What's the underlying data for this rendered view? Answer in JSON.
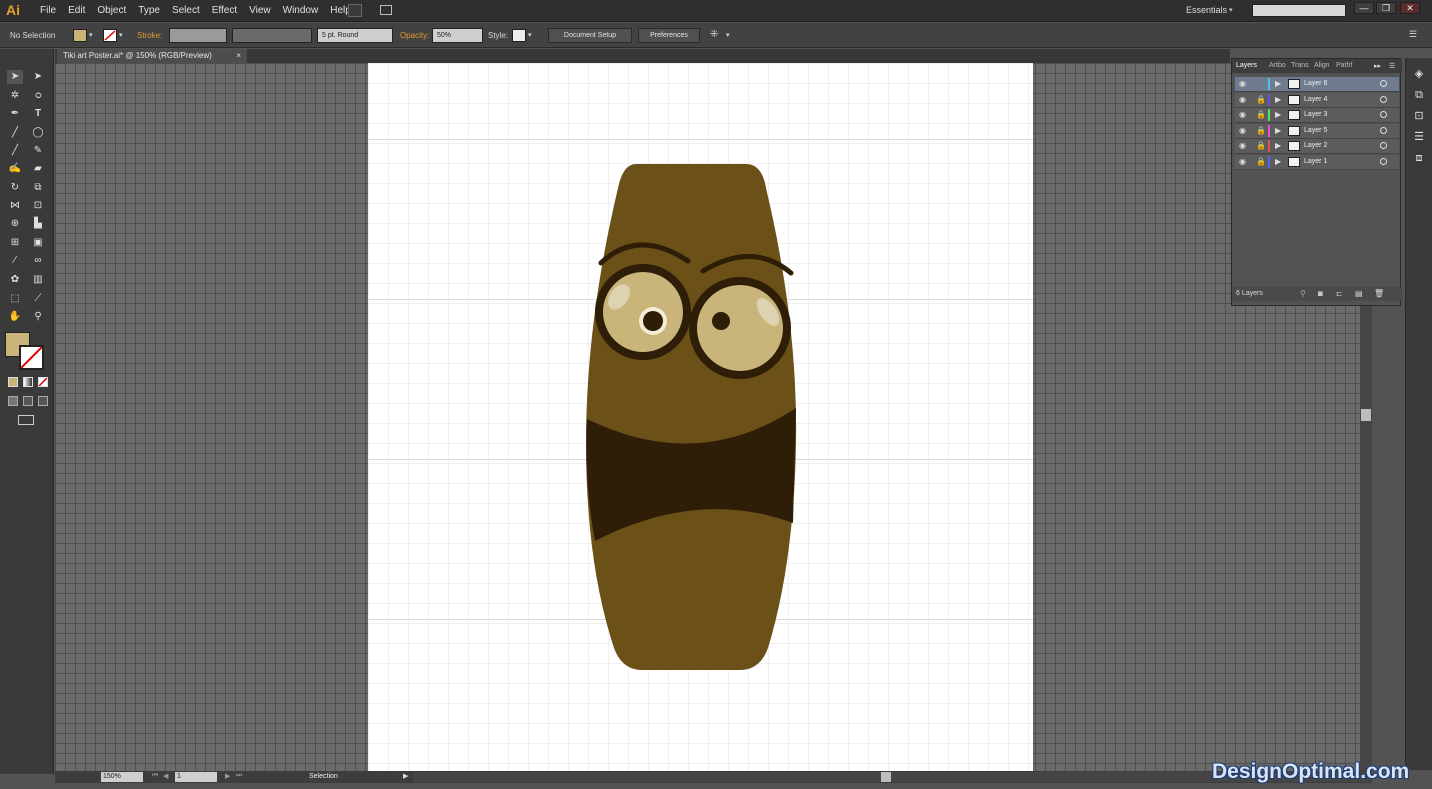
{
  "app": {
    "logo": "Ai",
    "menus": [
      "File",
      "Edit",
      "Object",
      "Type",
      "Select",
      "Effect",
      "View",
      "Window",
      "Help"
    ],
    "workspace": "Essentials",
    "window_buttons": [
      "—",
      "❐",
      "✕"
    ]
  },
  "control_bar": {
    "selection_label": "No Selection",
    "fill_color": "#c9b57a",
    "stroke_label": "Stroke:",
    "brush_label": "5 pt. Round",
    "opacity_label": "Opacity:",
    "opacity_value": "50%",
    "style_label": "Style:",
    "document_setup": "Document Setup",
    "preferences": "Preferences"
  },
  "document": {
    "tab_title": "Tiki art Poster.ai* @ 150% (RGB/Preview)",
    "close": "×"
  },
  "tools": {
    "fill_color": "#c9b57a"
  },
  "status_bar": {
    "zoom": "150%",
    "page": "1",
    "tool": "Selection"
  },
  "layers_panel": {
    "tabs": [
      "Layers",
      "Artbo",
      "Trans",
      "Align",
      "Pathf"
    ],
    "layers": [
      {
        "name": "Layer 6",
        "color": "#4ec4e6",
        "selected": true
      },
      {
        "name": "Layer 4",
        "color": "#6a4ee6",
        "selected": false
      },
      {
        "name": "Layer 3",
        "color": "#4ee65a",
        "selected": false
      },
      {
        "name": "Layer 5",
        "color": "#e64ee0",
        "selected": false
      },
      {
        "name": "Layer 2",
        "color": "#e64e4e",
        "selected": false
      },
      {
        "name": "Layer 1",
        "color": "#4e6ae6",
        "selected": false
      }
    ],
    "count": "6 Layers"
  },
  "artwork": {
    "body_color": "#6b5118",
    "band_color": "#2e1d07",
    "eye_color": "#c9b57a",
    "outline_color": "#2e1d07"
  },
  "watermark": "DesignOptimal.com"
}
